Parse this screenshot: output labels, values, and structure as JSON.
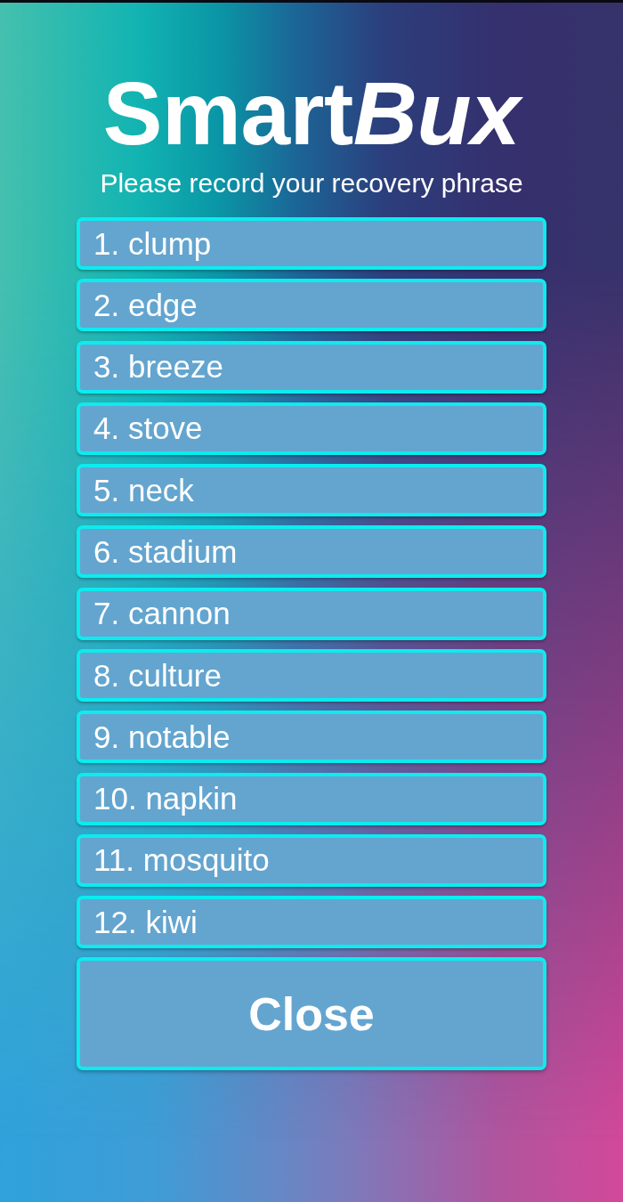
{
  "logo": {
    "parts": [
      {
        "text": "Smart",
        "italic": false
      },
      {
        "text": "Bux",
        "italic": true
      }
    ]
  },
  "subtitle": "Please record your recovery phrase",
  "words": [
    "1. clump",
    "2. edge",
    "3. breeze",
    "4. stove",
    "5. neck",
    "6. stadium",
    "7. cannon",
    "8. culture",
    "9. notable",
    "10. napkin",
    "11. mosquito",
    "12. kiwi"
  ],
  "close_button": {
    "label": "Close"
  }
}
